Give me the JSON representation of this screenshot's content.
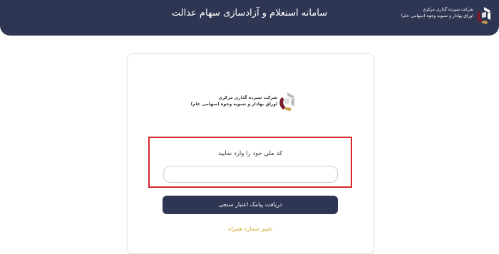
{
  "header": {
    "title": "سامانه استعلام و آزادسازی سهام عدالت",
    "logo_line1": "شرکت سپرده گذاری مرکزی",
    "logo_line2": "اوراق بهادار و تسویه وجوه (سهامی عام)"
  },
  "card": {
    "logo_line1": "شرکت سپرده گذاری مرکزی",
    "logo_line2": "اوراق بهادار و تسویه وجوه (سهامی عام)",
    "field_label": "کد ملی خود را وارد نمایید",
    "national_code_value": "",
    "submit_label": "دریافت پیامک اعتبار سنجی",
    "change_number_label": "تغییر شماره همراه"
  },
  "colors": {
    "header_bg": "#2f3654",
    "button_bg": "#2f3654",
    "highlight": "#d9262c",
    "link": "#d4a52a",
    "logo_maroon": "#7a1f2b",
    "logo_gold": "#c9a04a"
  }
}
